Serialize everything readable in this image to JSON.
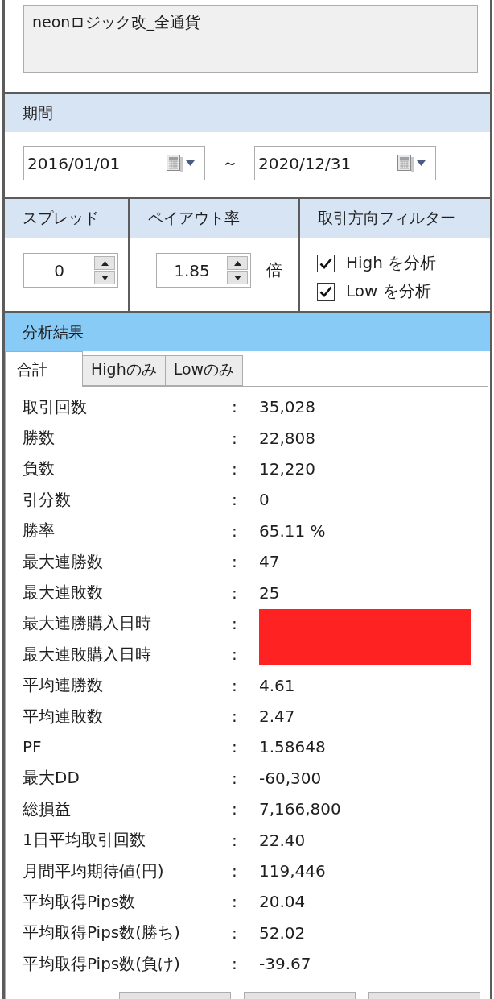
{
  "name_field": {
    "value": "neonロジック改_全通貨"
  },
  "period": {
    "title": "期間",
    "start": {
      "value": "2016/01/01"
    },
    "separator": "～",
    "end": {
      "value": "2020/12/31"
    }
  },
  "settings": [
    {
      "kind": "spinner",
      "title": "スプレッド",
      "value": "0"
    },
    {
      "kind": "spinner",
      "title": "ペイアウト率",
      "value": "1.85",
      "unit": "倍"
    },
    {
      "kind": "checklist",
      "title": "取引方向フィルター",
      "options": [
        {
          "label": "High を分析",
          "checked": true
        },
        {
          "label": "Low を分析",
          "checked": true
        }
      ]
    }
  ],
  "results": {
    "title": "分析結果",
    "tabs": [
      {
        "label": "合計",
        "selected": true
      },
      {
        "label": "Highのみ",
        "selected": false
      },
      {
        "label": "Lowのみ",
        "selected": false
      }
    ],
    "stats": [
      {
        "label": "取引回数",
        "separator": ":",
        "value": "35,028"
      },
      {
        "label": "勝数",
        "separator": ":",
        "value": "22,808"
      },
      {
        "label": "負数",
        "separator": ":",
        "value": "12,220"
      },
      {
        "label": "引分数",
        "separator": ":",
        "value": "0"
      },
      {
        "label": "勝率",
        "separator": ":",
        "value": "65.11 %"
      },
      {
        "label": "最大連勝数",
        "separator": ":",
        "value": "47"
      },
      {
        "label": "最大連敗数",
        "separator": ":",
        "value": "25"
      },
      {
        "label": "最大連勝購入日時",
        "separator": ":",
        "redacted": true
      },
      {
        "label": "最大連敗購入日時",
        "separator": ":",
        "redacted": true
      },
      {
        "label": "平均連勝数",
        "separator": ":",
        "value": "4.61"
      },
      {
        "label": "平均連敗数",
        "separator": ":",
        "value": "2.47"
      },
      {
        "label": "PF",
        "separator": ":",
        "value": "1.58648"
      },
      {
        "label": "最大DD",
        "separator": ":",
        "value": "-60,300"
      },
      {
        "label": "総損益",
        "separator": ":",
        "value": "7,166,800"
      },
      {
        "label": "1日平均取引回数",
        "separator": ":",
        "value": "22.40"
      },
      {
        "label": "月間平均期待値(円)",
        "separator": ":",
        "value": "119,446"
      },
      {
        "label": "平均取得Pips数",
        "separator": ":",
        "value": "20.04"
      },
      {
        "label": "平均取得Pips数(勝ち)",
        "separator": ":",
        "value": "52.02"
      },
      {
        "label": "平均取得Pips数(負け)",
        "separator": ":",
        "value": "-39.67"
      }
    ],
    "footer_buttons": [
      {
        "kind": "button"
      },
      {
        "kind": "button"
      },
      {
        "kind": "button"
      }
    ]
  }
}
